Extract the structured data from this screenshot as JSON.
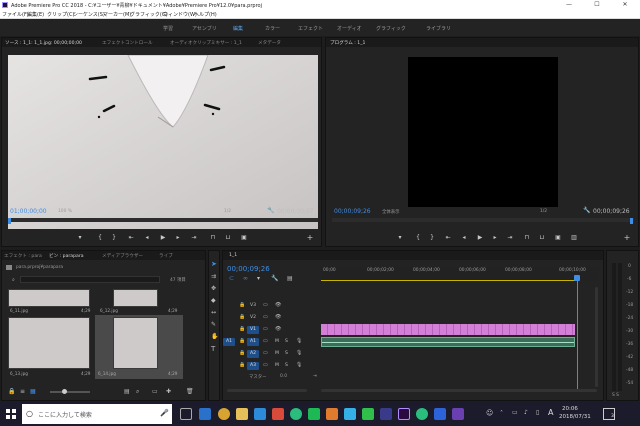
{
  "window": {
    "title": "Adobe Premiere Pro CC 2018 - C:¥ユーザー¥青柳¥ドキュメント¥Adobe¥Premiere Pro¥12.0¥para.prproj",
    "min": "—",
    "max": "☐",
    "close": "✕"
  },
  "menu": [
    "ファイル(F)",
    "編集(E)",
    "クリップ(C)",
    "シーケンス(S)",
    "マーカー(M)",
    "グラフィック(G)",
    "ウィンドウ(W)",
    "ヘルプ(H)"
  ],
  "workspaces": [
    "学習",
    "アセンブリ",
    "編集",
    "カラー",
    "エフェクト",
    "オーディオ",
    "グラフィック",
    "ライブラリ"
  ],
  "source": {
    "tabs": [
      "ソース : 1_1: 1_1.jpg: 00;00;00;00",
      "エフェクトコントロール",
      "オーディオクリップミキサー : 1_1",
      "メタデータ"
    ],
    "timecode": "01;00;00;00",
    "zoom": "100 %",
    "fraction": "1/2",
    "duration": "00;00;00;07"
  },
  "program": {
    "tab": "プログラム : 1_1",
    "timecode": "00;00;09;26",
    "fit": "全体表示",
    "fraction": "1/2",
    "duration": "00;00;09;26"
  },
  "project": {
    "tabs": [
      "エフェクト : para",
      "ビン : parapara",
      "メディアブラウザー",
      "ライブ"
    ],
    "path": "para.prproj¥parapara",
    "count": "47 項目",
    "search_placeholder": "",
    "items": [
      {
        "name": "6_11.jpg",
        "dur": "4;29"
      },
      {
        "name": "6_12.jpg",
        "dur": "4;29"
      },
      {
        "name": "6_13.jpg",
        "dur": "4;29"
      },
      {
        "name": "6_14.jpg",
        "dur": "4;29"
      }
    ]
  },
  "timeline": {
    "tab": "1_1",
    "timecode": "00;00;09;26",
    "ruler": [
      "00;00",
      "00;00;02;00",
      "00;00;04;00",
      "00;00;06;00",
      "00;00;08;00",
      "00;00;10;00"
    ],
    "video_tracks": [
      "V3",
      "V2",
      "V1"
    ],
    "audio_tracks": [
      "A1",
      "A2",
      "A3"
    ],
    "master": "マスター",
    "master_value": "0.0",
    "meter_scale": [
      "0",
      "-6",
      "-12",
      "-18",
      "-24",
      "-30",
      "-36",
      "-42",
      "-48",
      "-54"
    ],
    "meter_footer": "S  S"
  },
  "taskbar": {
    "search_placeholder": "ここに入力して検索",
    "time": "20:06",
    "date": "2018/07/31",
    "ime": "A",
    "notify_count": "3"
  }
}
